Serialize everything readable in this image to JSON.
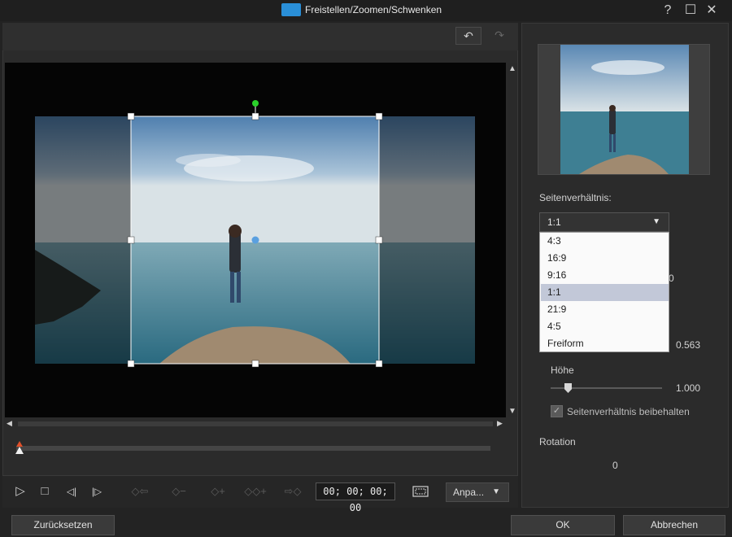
{
  "window": {
    "title": "Freistellen/Zoomen/Schwenken",
    "help": "?",
    "maximize": "☐",
    "close": "✕"
  },
  "toolbar": {
    "undo": "↶",
    "redo": "↷"
  },
  "controls": {
    "play": "▷",
    "stop": "□",
    "prev_frame": "◁|",
    "next_frame": "|▷",
    "kf_prev": "◇⇦",
    "kf_remove": "◇−",
    "kf_add": "◇+",
    "kf_duplicate": "◇◇+",
    "kf_next": "⇨◇",
    "timecode": "00; 00; 00; 00",
    "fit_label": "Anpa...",
    "fit_arrow": "▼"
  },
  "side": {
    "aspect_label": "Seitenverhältnis:",
    "aspect_value": "1:1",
    "aspect_arrow": "▼",
    "aspect_options": [
      "4:3",
      "16:9",
      "9:16",
      "1:1",
      "21:9",
      "4:5",
      "Freiform"
    ],
    "selected_option": "1:1",
    "partial_value_a": "0",
    "width_value": "0.563",
    "height_label": "Höhe",
    "height_value": "1.000",
    "keep_ratio_label": "Seitenverhältnis beibehalten",
    "keep_ratio_checked": true,
    "rotation_label": "Rotation",
    "rotation_value": "0"
  },
  "footer": {
    "reset": "Zurücksetzen",
    "ok": "OK",
    "cancel": "Abbrechen"
  }
}
